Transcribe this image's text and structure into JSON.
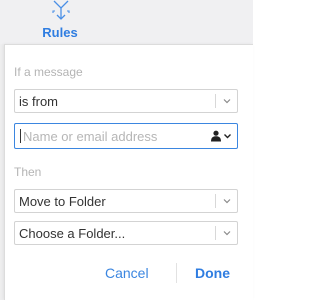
{
  "toolbar": {
    "rules_label": "Rules",
    "rules_icon": "rules-arrows-icon",
    "accent_color": "#2f7de1"
  },
  "rule_editor": {
    "condition_heading": "If a message",
    "condition_select": {
      "value": "is from",
      "icon": "chevron-down-icon"
    },
    "sender_input": {
      "value": "",
      "placeholder": "Name or email address",
      "icon": "contact-picker-icon"
    },
    "action_heading": "Then",
    "action_select": {
      "value": "Move to Folder",
      "icon": "chevron-down-icon"
    },
    "folder_select": {
      "value": "Choose a Folder...",
      "icon": "chevron-down-icon"
    },
    "cancel_label": "Cancel",
    "done_label": "Done"
  }
}
